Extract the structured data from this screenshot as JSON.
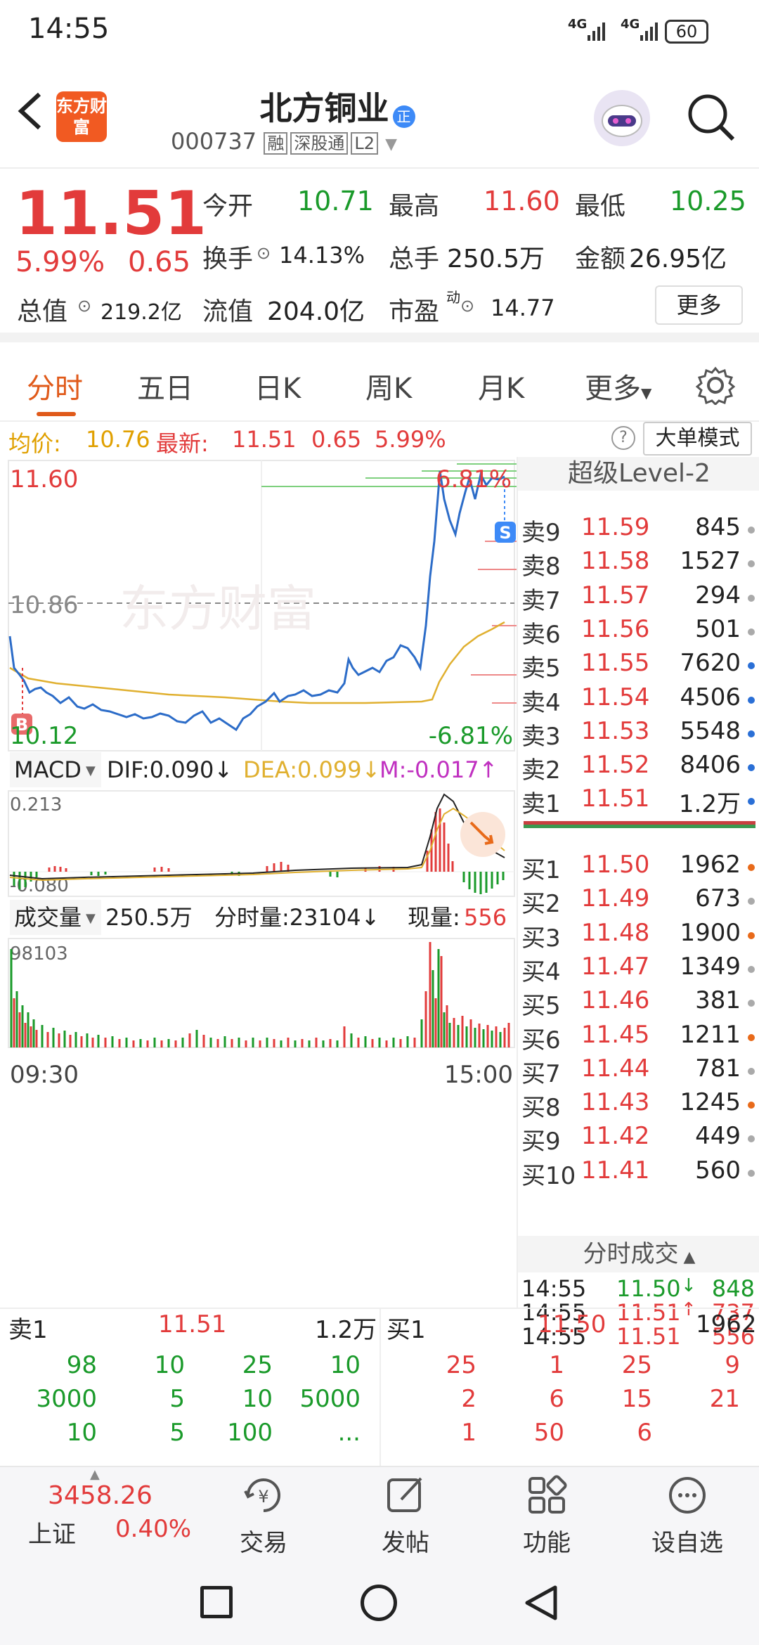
{
  "status_bar": {
    "time": "14:55",
    "signal1": "4G",
    "signal2": "4G",
    "battery": "60"
  },
  "header": {
    "back_icon": "back-arrow-icon",
    "logo_text": "东方财富",
    "stock_name": "北方铜业",
    "badge": "正",
    "code": "000737",
    "tags": [
      "融",
      "深股通",
      "L2"
    ]
  },
  "quote": {
    "price": "11.51",
    "change_pct": "5.99%",
    "change": "0.65",
    "open_label": "今开",
    "open": "10.71",
    "high_label": "最高",
    "high": "11.60",
    "low_label": "最低",
    "low": "10.25",
    "turnover_label": "换手",
    "turnover": "14.13%",
    "volume_label": "总手",
    "volume": "250.5万",
    "amount_label": "金额",
    "amount": "26.95亿",
    "mcap_label": "总值",
    "mcap": "219.2亿",
    "float_label": "流值",
    "float": "204.0亿",
    "pe_label": "市盈",
    "pe_sup": "动",
    "pe": "14.77",
    "more_button": "更多"
  },
  "tabs": [
    "分时",
    "五日",
    "日K",
    "周K",
    "月K",
    "更多"
  ],
  "avg": {
    "avg_label": "均价:",
    "avg": "10.76",
    "latest_label": "最新:",
    "latest": "11.51",
    "chg": "0.65",
    "pct": "5.99%",
    "mode_button": "大单模式"
  },
  "chart": {
    "high": "11.60",
    "high_pct": "6.81%",
    "mid": "10.86",
    "low": "10.12",
    "low_pct": "-6.81%",
    "watermark": "东方财富",
    "b_marker": "B",
    "s_marker": "S",
    "macd_select": "MACD",
    "dif": "DIF:0.090↓",
    "dea": "DEA:0.099↓",
    "m": "M:-0.017↑",
    "macd_top": "0.213",
    "macd_bottom": "-0.080",
    "vol_select": "成交量",
    "vol_total": "250.5万",
    "vol_tick_label": "分时量:23104↓",
    "vol_now_label": "现量:",
    "vol_now": "556",
    "vol_max": "98103",
    "time_start": "09:30",
    "time_end": "15:00"
  },
  "level2": {
    "title": "超级Level-2",
    "asks": [
      {
        "label": "卖9",
        "price": "11.59",
        "vol": "845",
        "dot": "#aaaaaa"
      },
      {
        "label": "卖8",
        "price": "11.58",
        "vol": "1527",
        "dot": "#aaaaaa"
      },
      {
        "label": "卖7",
        "price": "11.57",
        "vol": "294",
        "dot": "#aaaaaa"
      },
      {
        "label": "卖6",
        "price": "11.56",
        "vol": "501",
        "dot": "#aaaaaa"
      },
      {
        "label": "卖5",
        "price": "11.55",
        "vol": "7620",
        "dot": "#2a6fd6"
      },
      {
        "label": "卖4",
        "price": "11.54",
        "vol": "4506",
        "dot": "#2a6fd6"
      },
      {
        "label": "卖3",
        "price": "11.53",
        "vol": "5548",
        "dot": "#2a6fd6"
      },
      {
        "label": "卖2",
        "price": "11.52",
        "vol": "8406",
        "dot": "#2a6fd6"
      },
      {
        "label": "卖1",
        "price": "11.51",
        "vol": "1.2万",
        "dot": "#2a6fd6"
      }
    ],
    "bids": [
      {
        "label": "买1",
        "price": "11.50",
        "vol": "1962",
        "dot": "#e86a1a"
      },
      {
        "label": "买2",
        "price": "11.49",
        "vol": "673",
        "dot": "#aaaaaa"
      },
      {
        "label": "买3",
        "price": "11.48",
        "vol": "1900",
        "dot": "#e86a1a"
      },
      {
        "label": "买4",
        "price": "11.47",
        "vol": "1349",
        "dot": "#aaaaaa"
      },
      {
        "label": "买5",
        "price": "11.46",
        "vol": "381",
        "dot": "#aaaaaa"
      },
      {
        "label": "买6",
        "price": "11.45",
        "vol": "1211",
        "dot": "#e86a1a"
      },
      {
        "label": "买7",
        "price": "11.44",
        "vol": "781",
        "dot": "#aaaaaa"
      },
      {
        "label": "买8",
        "price": "11.43",
        "vol": "1245",
        "dot": "#e86a1a"
      },
      {
        "label": "买9",
        "price": "11.42",
        "vol": "449",
        "dot": "#aaaaaa"
      },
      {
        "label": "买10",
        "price": "11.41",
        "vol": "560",
        "dot": "#aaaaaa"
      }
    ],
    "ticks_title": "分时成交",
    "ticks": [
      {
        "time": "14:55",
        "price": "11.50",
        "arrow": "↓",
        "vol": "848",
        "color": "#1a9a2a"
      },
      {
        "time": "14:55",
        "price": "11.51",
        "arrow": "↑",
        "vol": "737",
        "color": "#e23b3b"
      },
      {
        "time": "14:55",
        "price": "11.51",
        "arrow": "",
        "vol": "556",
        "color": "#e23b3b"
      }
    ]
  },
  "book": {
    "sell_label": "卖1",
    "sell_price": "11.51",
    "sell_vol": "1.2万",
    "buy_label": "买1",
    "buy_price": "11.50",
    "buy_vol": "1962",
    "sell_rows": [
      [
        "98",
        "10",
        "25",
        "10"
      ],
      [
        "3000",
        "5",
        "10",
        "5000"
      ],
      [
        "10",
        "5",
        "100",
        "..."
      ]
    ],
    "buy_rows": [
      [
        "25",
        "1",
        "25",
        "9"
      ],
      [
        "2",
        "6",
        "15",
        "21"
      ],
      [
        "1",
        "50",
        "6",
        ""
      ]
    ]
  },
  "bottom": {
    "index_value": "3458.26",
    "index_name": "上证",
    "index_pct": "0.40%",
    "items": [
      "交易",
      "发帖",
      "功能",
      "设自选"
    ]
  }
}
